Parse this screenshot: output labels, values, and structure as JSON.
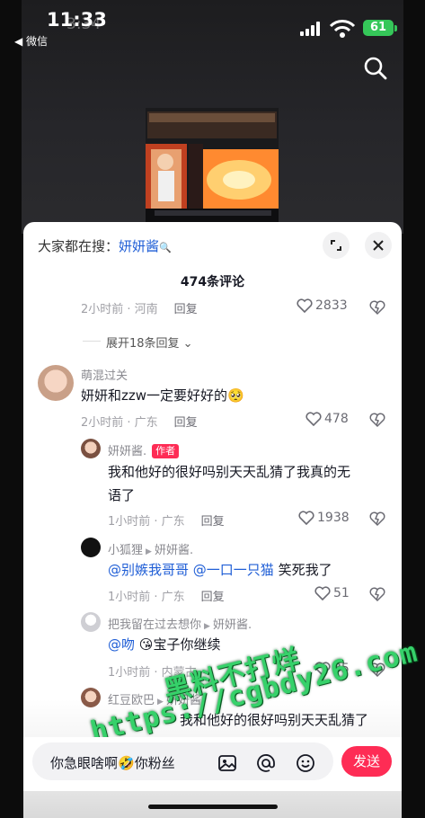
{
  "status_bar": {
    "time": "11:33",
    "time_ghost": "3:34",
    "back_app": "◀ 微信",
    "battery": "61"
  },
  "sheet": {
    "suggest_prefix": "大家都在搜：",
    "suggest_keyword": "妍妍酱",
    "comment_count": "474条评论"
  },
  "comments": [
    {
      "meta": "2小时前 · 河南",
      "reply": "回复",
      "likes": "2833"
    },
    {
      "expand_replies": "展开18条回复"
    },
    {
      "user": "萌混过关",
      "text": "妍妍和zzw一定要好好的",
      "emoji": "🥺",
      "meta": "2小时前 · 广东",
      "reply": "回复",
      "likes": "478"
    },
    {
      "user": "妍妍酱.",
      "tag": "作者",
      "text_line1": "我和他好的很好吗别天天乱猜了我真的无",
      "text_line2": "语了",
      "meta": "1小时前 · 广东",
      "reply": "回复",
      "likes": "1938"
    },
    {
      "user": "小狐狸",
      "reply_to": "妍妍酱.",
      "mention1": "@别嫉我哥哥",
      "mention2": "@一口一只猫",
      "text": "笑死我了",
      "meta": "1小时前 · 广东",
      "reply": "回复",
      "likes": "51"
    },
    {
      "user": "把我留在过去想你",
      "reply_to": "妍妍酱.",
      "mention1": "@吻",
      "emoji": "😘",
      "text": "宝子你继续",
      "meta": "1小时前 · 内蒙古",
      "likes": "35"
    },
    {
      "user": "红豆欧巴",
      "reply_to": "妍妍酱.",
      "text": "我和他好的很好吗别天天乱猜了"
    }
  ],
  "input_bar": {
    "text": "你急眼啥啊",
    "emoji": "🤣",
    "text2": "你粉丝",
    "send": "发送"
  },
  "watermark": {
    "line1": "黑料不打烊",
    "line2": "https://cgbdy26.com"
  },
  "colors": {
    "accent": "#fe2c55",
    "mention": "#1f5ed6",
    "battery": "#35c759",
    "watermark": "#36d16a"
  }
}
